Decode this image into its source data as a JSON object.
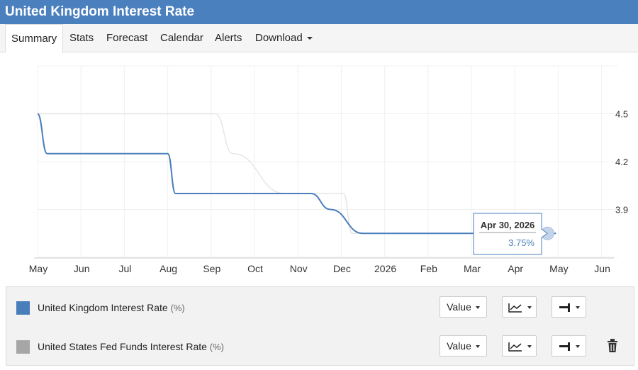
{
  "header": {
    "title": "United Kingdom Interest Rate"
  },
  "tabs": [
    {
      "label": "Summary",
      "active": true
    },
    {
      "label": "Stats"
    },
    {
      "label": "Forecast"
    },
    {
      "label": "Calendar"
    },
    {
      "label": "Alerts"
    },
    {
      "label": "Download",
      "dropdown": true
    }
  ],
  "chart_data": {
    "type": "line",
    "x_ticks": [
      "May",
      "Jun",
      "Jul",
      "Aug",
      "Sep",
      "Oct",
      "Nov",
      "Dec",
      "2026",
      "Feb",
      "Mar",
      "Apr",
      "May",
      "Jun"
    ],
    "y_ticks": [
      "3.9",
      "4.2",
      "4.5"
    ],
    "ylim": [
      3.6,
      4.8
    ],
    "grid": true,
    "series": [
      {
        "name": "United Kingdom Interest Rate",
        "color": "#4a7ebb",
        "points": [
          {
            "x": 0.0,
            "y": 4.5
          },
          {
            "x": 0.22,
            "y": 4.25
          },
          {
            "x": 3.0,
            "y": 4.25
          },
          {
            "x": 3.18,
            "y": 4.0
          },
          {
            "x": 6.3,
            "y": 4.0
          },
          {
            "x": 6.75,
            "y": 3.9
          },
          {
            "x": 7.5,
            "y": 3.75
          },
          {
            "x": 11.95,
            "y": 3.75
          }
        ]
      },
      {
        "name": "United States Fed Funds Interest Rate",
        "color": "#e6e6e6",
        "points": [
          {
            "x": 0.0,
            "y": 4.5
          },
          {
            "x": 4.1,
            "y": 4.5
          },
          {
            "x": 4.5,
            "y": 4.25
          },
          {
            "x": 5.7,
            "y": 4.0
          },
          {
            "x": 7.05,
            "y": 4.0
          },
          {
            "x": 7.25,
            "y": 3.75
          },
          {
            "x": 11.95,
            "y": 3.75
          }
        ]
      }
    ],
    "tooltip": {
      "date": "Apr 30, 2026",
      "value": "3.75%"
    }
  },
  "legend": {
    "items": [
      {
        "label": "United Kingdom Interest Rate",
        "unit": "(%)",
        "color": "#4a7ebb",
        "value_label": "Value",
        "deletable": false
      },
      {
        "label": "United States Fed Funds Interest Rate",
        "unit": "(%)",
        "color": "#a6a6a6",
        "value_label": "Value",
        "deletable": true
      }
    ]
  }
}
